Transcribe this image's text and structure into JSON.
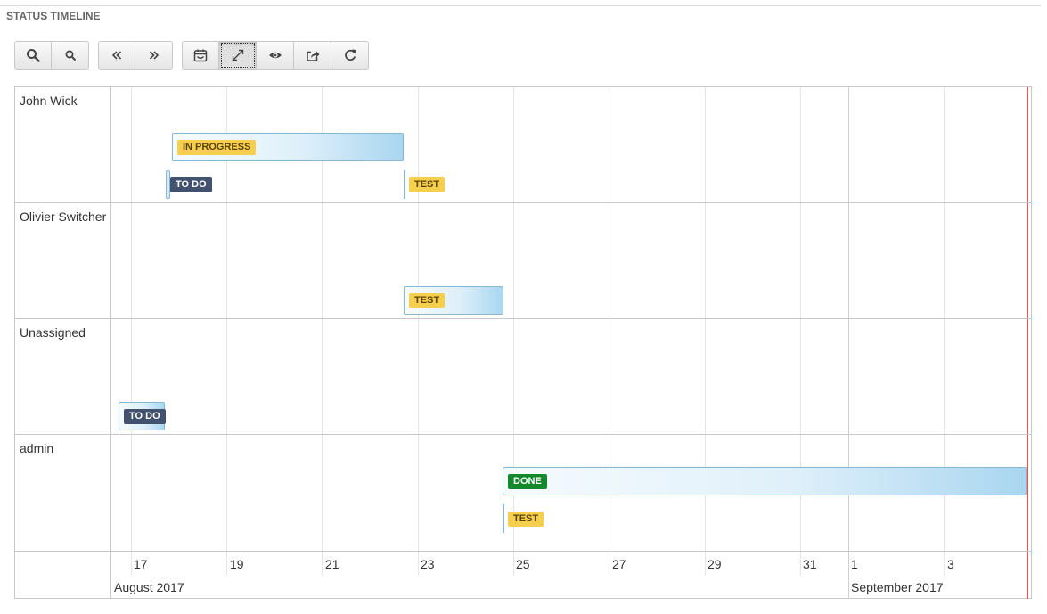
{
  "panel": {
    "title": "STATUS TIMELINE"
  },
  "toolbar": {
    "groups": [
      [
        "zoom-in-icon",
        "zoom-out-icon"
      ],
      [
        "double-left-chevron-icon",
        "double-right-chevron-icon"
      ],
      [
        "calendar-icon",
        "expand-icon",
        "eye-icon",
        "share-icon",
        "refresh-icon"
      ]
    ],
    "active_button": "expand-icon"
  },
  "rows": [
    {
      "label": "John Wick"
    },
    {
      "label": "Olivier Switcher"
    },
    {
      "label": "Unassigned"
    },
    {
      "label": "admin"
    }
  ],
  "statuses": {
    "in_progress": "IN PROGRESS",
    "todo": "TO DO",
    "test": "TEST",
    "done": "DONE"
  },
  "axis": {
    "minor": [
      "17",
      "19",
      "21",
      "23",
      "25",
      "27",
      "29",
      "31",
      "1",
      "3"
    ],
    "major": [
      "August 2017",
      "September 2017"
    ]
  },
  "colors": {
    "todo": "#42526e",
    "in_progress": "#f7cf4f",
    "test": "#f7cf4f",
    "done": "#14892c",
    "now_line": "#e0584f",
    "item_fill": "#a9d6f0"
  }
}
